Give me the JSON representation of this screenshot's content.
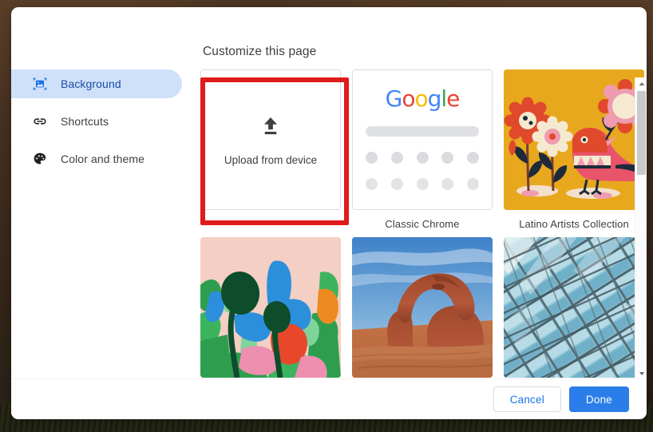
{
  "dialog": {
    "title": "Customize this page"
  },
  "sidebar": {
    "items": [
      {
        "label": "Background",
        "icon": "image-icon",
        "active": true
      },
      {
        "label": "Shortcuts",
        "icon": "link-icon",
        "active": false
      },
      {
        "label": "Color and theme",
        "icon": "palette-icon",
        "active": false
      }
    ]
  },
  "tiles": [
    {
      "id": "upload",
      "label": "",
      "upload_text": "Upload from device",
      "icon": "upload-icon",
      "highlighted": true
    },
    {
      "id": "classic-chrome",
      "label": "Classic Chrome",
      "logo": "Google"
    },
    {
      "id": "latino-artists",
      "label": "Latino Artists Collection"
    },
    {
      "id": "art-flowers",
      "label": ""
    },
    {
      "id": "art-arch",
      "label": ""
    },
    {
      "id": "art-glass",
      "label": ""
    }
  ],
  "scrollbar": {
    "up_icon": "triangle-up-icon",
    "down_icon": "triangle-down-icon"
  },
  "footer": {
    "cancel_label": "Cancel",
    "done_label": "Done"
  },
  "colors": {
    "accent": "#1a73e8",
    "done_button": "#2b7de9",
    "active_nav_bg": "#cfe0f9",
    "active_nav_text": "#174ea6",
    "highlight_red": "#e01b1b",
    "latino_bg": "#e8a81e"
  }
}
